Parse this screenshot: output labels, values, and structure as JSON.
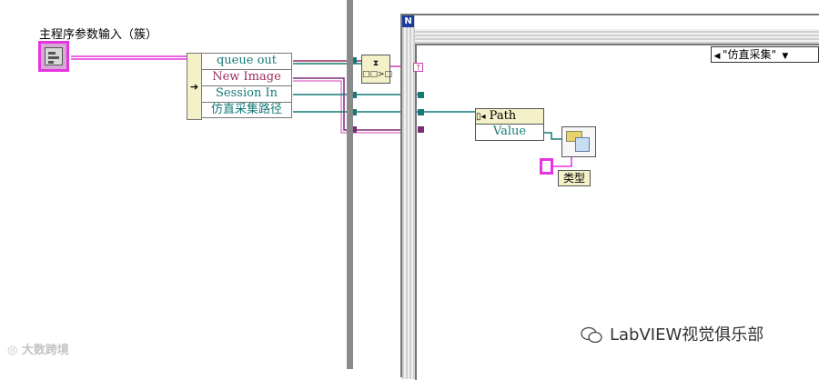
{
  "cluster": {
    "label": "主程序参数输入（簇）"
  },
  "unbundle_by_name": {
    "rows": [
      "queue out",
      "New Image",
      "Session In",
      "仿直采集路径"
    ]
  },
  "case_structure": {
    "selector_value": "\"仿直采集\"",
    "selector_arrow": "▼",
    "n_terminal": "N"
  },
  "dequeue_node": {
    "line1": "⧗",
    "line2": "□□>□"
  },
  "error_terminal": "?",
  "property_node": {
    "header": "Path",
    "value": "Value",
    "header_icon": "property-node-icon"
  },
  "type_constant": {
    "label": "类型"
  },
  "watermarks": {
    "left": "大数跨境",
    "right": "LabVIEW视觉俱乐部"
  },
  "colors": {
    "cluster_wire": "#e535e0",
    "refnum_wire": "#157a77",
    "error_wire": "#7a2a7a",
    "divider": "#8a8a8a"
  }
}
